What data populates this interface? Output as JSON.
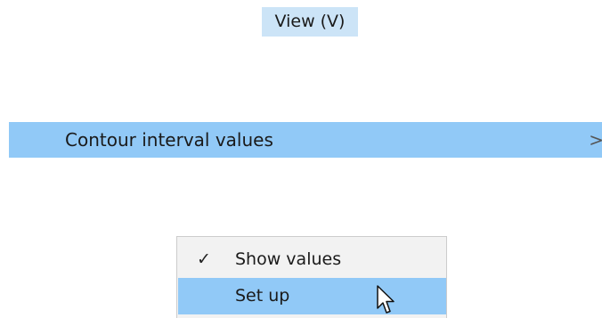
{
  "menubar": {
    "view_label": "View (V)"
  },
  "submenu": {
    "contour_label": "Contour interval values",
    "contour_arrow": ">"
  },
  "popup": {
    "items": [
      {
        "label": "Show values",
        "checked": true,
        "check_glyph": "✓"
      },
      {
        "label": "Set up",
        "checked": false,
        "highlighted": true
      }
    ]
  },
  "colors": {
    "menubar_highlight": "#cce4f7",
    "menu_highlight": "#91c9f7",
    "popup_background": "#f2f2f2"
  },
  "icons": {
    "check": "checkmark-icon",
    "arrow": "chevron-right-icon",
    "pointer": "mouse-pointer-icon"
  }
}
